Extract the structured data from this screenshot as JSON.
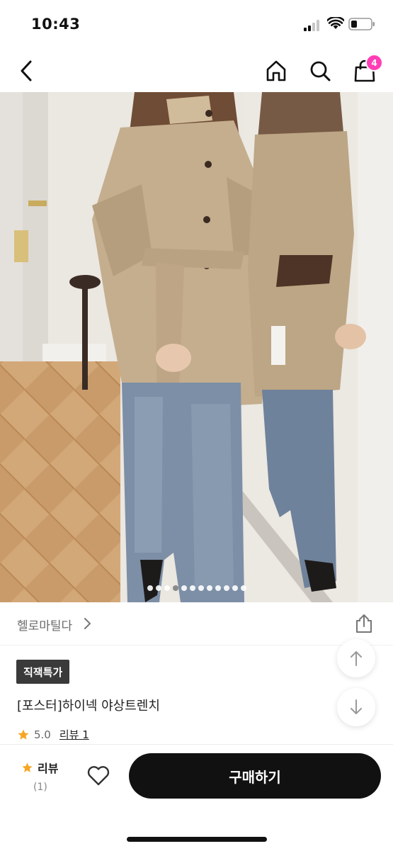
{
  "status_bar": {
    "time": "10:43"
  },
  "nav": {
    "back_icon": "chevron-left-icon",
    "home_icon": "home-icon",
    "search_icon": "search-icon",
    "cart_icon": "shopping-bag-icon",
    "cart_count": "4"
  },
  "gallery": {
    "total_images": 12,
    "current_index": 4
  },
  "seller": {
    "name": "헬로마틸다"
  },
  "product": {
    "badge": "직잭특가",
    "title": "[포스터]하이넥 야상트렌치",
    "rating": "5.0",
    "review_link": "리뷰 1"
  },
  "bottom_bar": {
    "review_label": "리뷰",
    "review_count": "(1)",
    "buy_label": "구매하기"
  },
  "colors": {
    "accent": "#ff3eb5",
    "star": "#f5a623",
    "button": "#111111"
  }
}
